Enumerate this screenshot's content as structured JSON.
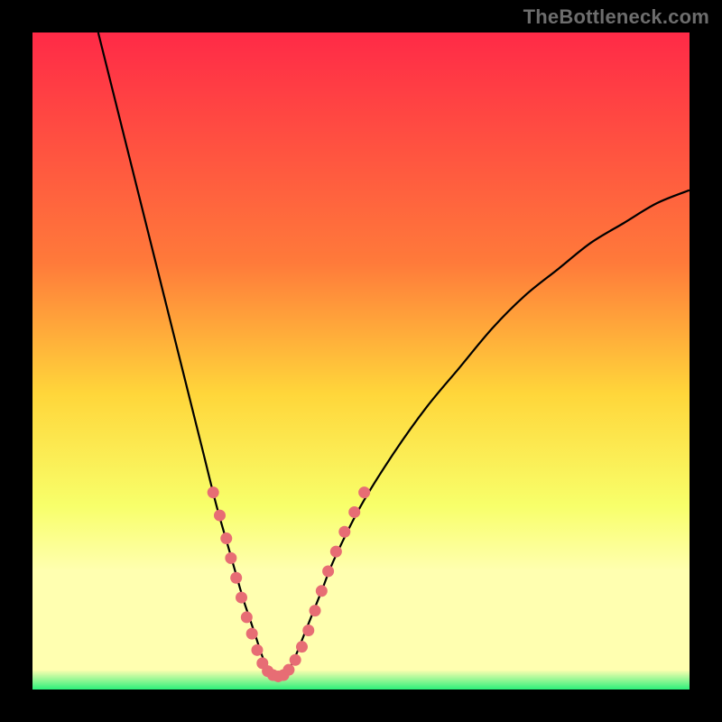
{
  "watermark": "TheBottleneck.com",
  "colors": {
    "top": "#ff2a47",
    "mid_upper": "#ff7a3a",
    "mid": "#ffd63a",
    "mid_lower": "#f8ff6a",
    "pale_yellow": "#ffffb0",
    "bottom": "#2df07a",
    "curve": "#000000",
    "markers": "#e76d74",
    "frame": "#000000"
  },
  "chart_data": {
    "type": "line",
    "title": "",
    "xlabel": "",
    "ylabel": "",
    "xlim": [
      0,
      100
    ],
    "ylim": [
      0,
      100
    ],
    "series": [
      {
        "name": "bottleneck-curve",
        "x": [
          10,
          12,
          14,
          16,
          18,
          20,
          22,
          24,
          26,
          28,
          30,
          32,
          33,
          34,
          35,
          36,
          37,
          38,
          39,
          40,
          42,
          44,
          46,
          50,
          55,
          60,
          65,
          70,
          75,
          80,
          85,
          90,
          95,
          100
        ],
        "y": [
          100,
          92,
          84,
          76,
          68,
          60,
          52,
          44,
          36,
          28,
          21,
          14,
          11,
          8,
          5,
          3,
          2,
          2,
          3,
          5,
          10,
          15,
          20,
          28,
          36,
          43,
          49,
          55,
          60,
          64,
          68,
          71,
          74,
          76
        ]
      }
    ],
    "markers": {
      "name": "highlight-dots",
      "points": [
        {
          "x": 27.5,
          "y": 30
        },
        {
          "x": 28.5,
          "y": 26.5
        },
        {
          "x": 29.5,
          "y": 23
        },
        {
          "x": 30.2,
          "y": 20
        },
        {
          "x": 31.0,
          "y": 17
        },
        {
          "x": 31.8,
          "y": 14
        },
        {
          "x": 32.6,
          "y": 11
        },
        {
          "x": 33.4,
          "y": 8.5
        },
        {
          "x": 34.2,
          "y": 6
        },
        {
          "x": 35.0,
          "y": 4
        },
        {
          "x": 35.8,
          "y": 2.8
        },
        {
          "x": 36.6,
          "y": 2.2
        },
        {
          "x": 37.4,
          "y": 2.0
        },
        {
          "x": 38.2,
          "y": 2.2
        },
        {
          "x": 39.0,
          "y": 3.0
        },
        {
          "x": 40.0,
          "y": 4.5
        },
        {
          "x": 41.0,
          "y": 6.5
        },
        {
          "x": 42.0,
          "y": 9
        },
        {
          "x": 43.0,
          "y": 12
        },
        {
          "x": 44.0,
          "y": 15
        },
        {
          "x": 45.0,
          "y": 18
        },
        {
          "x": 46.2,
          "y": 21
        },
        {
          "x": 47.5,
          "y": 24
        },
        {
          "x": 49.0,
          "y": 27
        },
        {
          "x": 50.5,
          "y": 30
        }
      ]
    },
    "gradient_stops": [
      {
        "offset": 0.0,
        "color_key": "top"
      },
      {
        "offset": 0.35,
        "color_key": "mid_upper"
      },
      {
        "offset": 0.55,
        "color_key": "mid"
      },
      {
        "offset": 0.72,
        "color_key": "mid_lower"
      },
      {
        "offset": 0.82,
        "color_key": "pale_yellow"
      },
      {
        "offset": 0.97,
        "color_key": "pale_yellow"
      },
      {
        "offset": 1.0,
        "color_key": "bottom"
      }
    ]
  }
}
